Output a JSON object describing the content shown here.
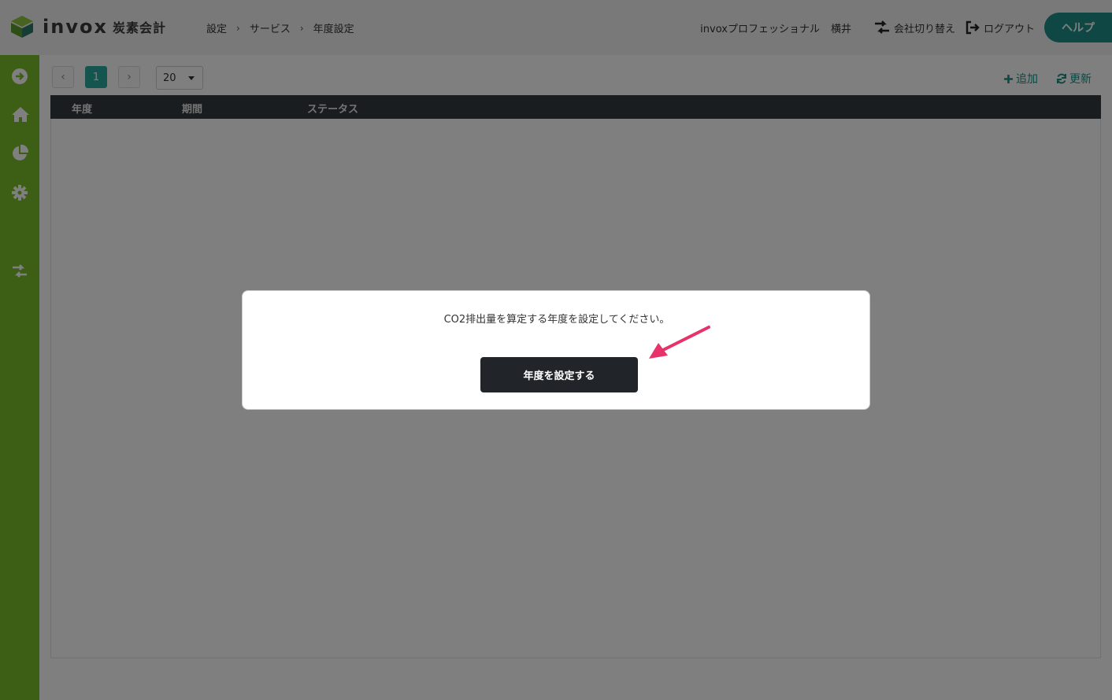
{
  "header": {
    "logo_text": "invox",
    "logo_sub": "炭素会計",
    "breadcrumb": [
      "設定",
      "サービス",
      "年度設定"
    ],
    "company": "invoxプロフェッショナル",
    "user": "横井",
    "switch_company": "会社切り替え",
    "logout": "ログアウト",
    "help": "ヘルプ"
  },
  "sidebar": {
    "icons": [
      "arrow-right-circle-icon",
      "home-icon",
      "pie-chart-icon",
      "gear-icon",
      "switch-icon"
    ]
  },
  "toolbar": {
    "prev": "‹",
    "current_page": "1",
    "next": "›",
    "per_page": "20",
    "add": "追加",
    "refresh": "更新"
  },
  "table": {
    "columns": [
      "年度",
      "期間",
      "ステータス"
    ],
    "rows": []
  },
  "modal": {
    "message": "CO2排出量を算定する年度を設定してください。",
    "button": "年度を設定する"
  },
  "colors": {
    "sidebar": "#7bbf2a",
    "accent": "#1d8f86",
    "table_header": "#333a40",
    "arrow": "#e8336a"
  }
}
